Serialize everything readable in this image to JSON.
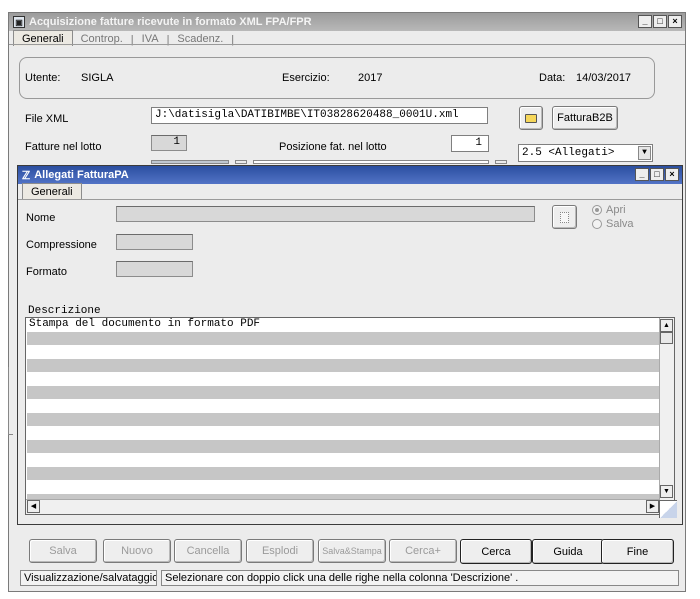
{
  "main_window": {
    "title": "Acquisizione fatture ricevute in formato XML FPA/FPR",
    "tabs": [
      {
        "label": "Generali"
      },
      {
        "label": "Controp."
      },
      {
        "label": "IVA"
      },
      {
        "label": "Scadenz."
      }
    ],
    "utente_label": "Utente:",
    "utente_value": "SIGLA",
    "esercizio_label": "Esercizio:",
    "esercizio_value": "2017",
    "data_label": "Data:",
    "data_value": "14/03/2017",
    "file_xml_label": "File XML",
    "file_xml_value": "J:\\datisigla\\DATIBIMBE\\IT03828620488_0001U.xml",
    "fatturab2b_label": "FatturaB2B",
    "fatture_lotto_label": "Fatture nel lotto",
    "fatture_lotto_value": "1",
    "posizione_label": "Posizione fat. nel lotto",
    "posizione_value": "1",
    "allegati_select_value": "2.5 <Allegati>"
  },
  "dialog": {
    "title": "Allegati FatturaPA",
    "tab_label": "Generali",
    "nome_label": "Nome",
    "compressione_label": "Compressione",
    "formato_label": "Formato",
    "radio_apri": "Apri",
    "radio_salva": "Salva",
    "descrizione_label": "Descrizione",
    "descrizione_rows": [
      "Stampa del documento in formato PDF",
      "",
      "",
      "",
      "",
      "",
      "",
      "",
      "",
      "",
      "",
      "",
      "",
      ""
    ]
  },
  "footer": {
    "buttons": [
      {
        "label": "Salva",
        "enabled": false
      },
      {
        "label": "Nuovo",
        "enabled": false
      },
      {
        "label": "Cancella",
        "enabled": false
      },
      {
        "label": "Esplodi",
        "enabled": false
      },
      {
        "label": "Salva&Stampa",
        "enabled": false
      },
      {
        "label": "Cerca+",
        "enabled": false
      },
      {
        "label": "Cerca",
        "enabled": true
      },
      {
        "label": "Guida",
        "enabled": true
      },
      {
        "label": "Fine",
        "enabled": true
      }
    ],
    "status_left": "Visualizzazione/salvataggio.",
    "status_right": "Selezionare con doppio click una delle righe nella colonna 'Descrizione' ."
  }
}
